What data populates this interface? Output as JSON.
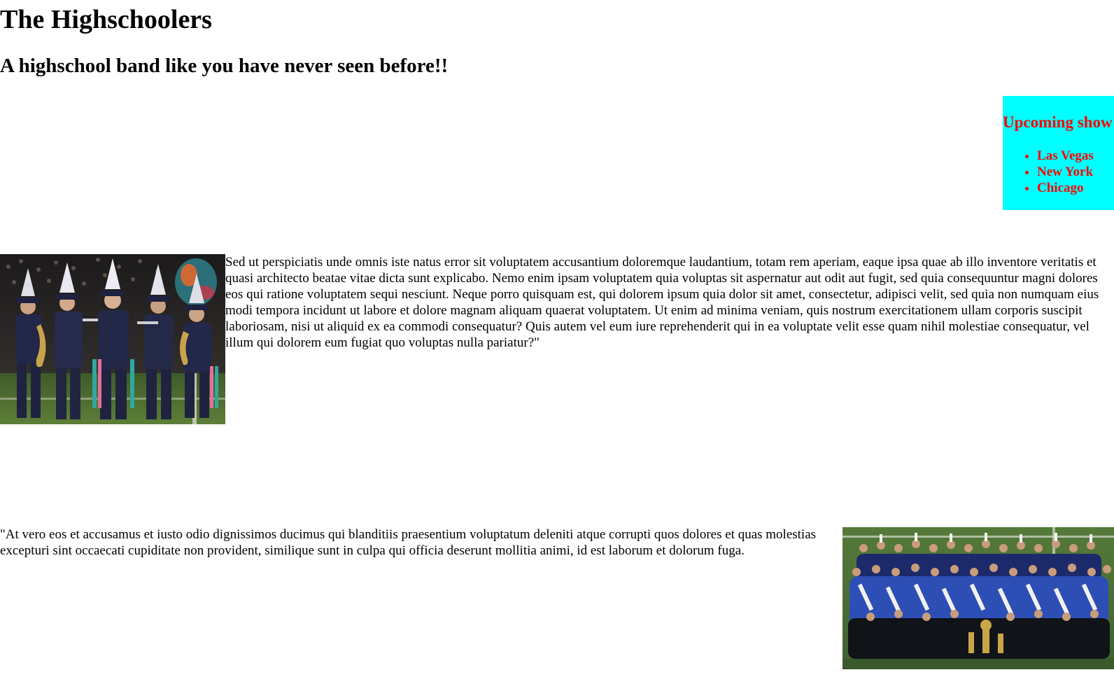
{
  "header": {
    "title": "The Highschoolers",
    "tagline": "A highschool band like you have never seen before!!"
  },
  "colors": {
    "shows_background": "#00ffff",
    "shows_text": "#ff0000"
  },
  "upcoming_shows": {
    "heading": "Upcoming show",
    "cities": [
      "Las Vegas",
      "New York",
      "Chicago"
    ]
  },
  "sections": [
    {
      "image": "marching-band-performance-photo",
      "text": "Sed ut perspiciatis unde omnis iste natus error sit voluptatem accusantium doloremque laudantium, totam rem aperiam, eaque ipsa quae ab illo inventore veritatis et quasi architecto beatae vitae dicta sunt explicabo. Nemo enim ipsam voluptatem quia voluptas sit aspernatur aut odit aut fugit, sed quia consequuntur magni dolores eos qui ratione voluptatem sequi nesciunt. Neque porro quisquam est, qui dolorem ipsum quia dolor sit amet, consectetur, adipisci velit, sed quia non numquam eius modi tempora incidunt ut labore et dolore magnam aliquam quaerat voluptatem. Ut enim ad minima veniam, quis nostrum exercitationem ullam corporis suscipit laboriosam, nisi ut aliquid ex ea commodi consequatur? Quis autem vel eum iure reprehenderit qui in ea voluptate velit esse quam nihil molestiae consequatur, vel illum qui dolorem eum fugiat quo voluptas nulla pariatur?\""
    },
    {
      "image": "band-group-photo",
      "text": "\"At vero eos et accusamus et iusto odio dignissimos ducimus qui blanditiis praesentium voluptatum deleniti atque corrupti quos dolores et quas molestias excepturi sint occaecati cupiditate non provident, similique sunt in culpa qui officia deserunt mollitia animi, id est laborum et dolorum fuga."
    }
  ]
}
